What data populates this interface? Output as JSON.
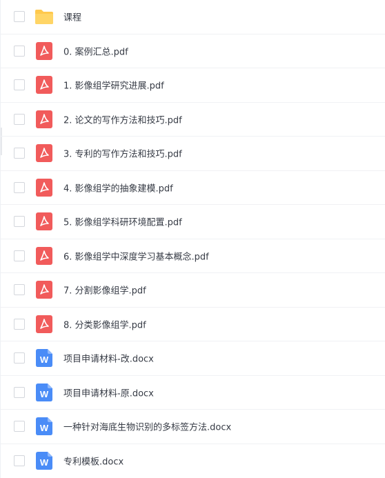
{
  "files": [
    {
      "name": "课程",
      "icon": "folder-icon"
    },
    {
      "name": "0. 案例汇总.pdf",
      "icon": "pdf-icon"
    },
    {
      "name": "1. 影像组学研究进展.pdf",
      "icon": "pdf-icon"
    },
    {
      "name": "2. 论文的写作方法和技巧.pdf",
      "icon": "pdf-icon"
    },
    {
      "name": "3. 专利的写作方法和技巧.pdf",
      "icon": "pdf-icon"
    },
    {
      "name": "4. 影像组学的抽象建模.pdf",
      "icon": "pdf-icon"
    },
    {
      "name": "5. 影像组学科研环境配置.pdf",
      "icon": "pdf-icon"
    },
    {
      "name": "6. 影像组学中深度学习基本概念.pdf",
      "icon": "pdf-icon"
    },
    {
      "name": "7. 分割影像组学.pdf",
      "icon": "pdf-icon"
    },
    {
      "name": "8. 分类影像组学.pdf",
      "icon": "pdf-icon"
    },
    {
      "name": "项目申请材料-改.docx",
      "icon": "word-icon"
    },
    {
      "name": "项目申请材料-原.docx",
      "icon": "word-icon"
    },
    {
      "name": "一种针对海底生物识别的多标签方法.docx",
      "icon": "word-icon"
    },
    {
      "name": "专利模板.docx",
      "icon": "word-icon"
    }
  ],
  "colors": {
    "folder": "#ffc94d",
    "pdf": "#f15b5b",
    "word": "#4a8cf7",
    "text": "#353a44"
  }
}
